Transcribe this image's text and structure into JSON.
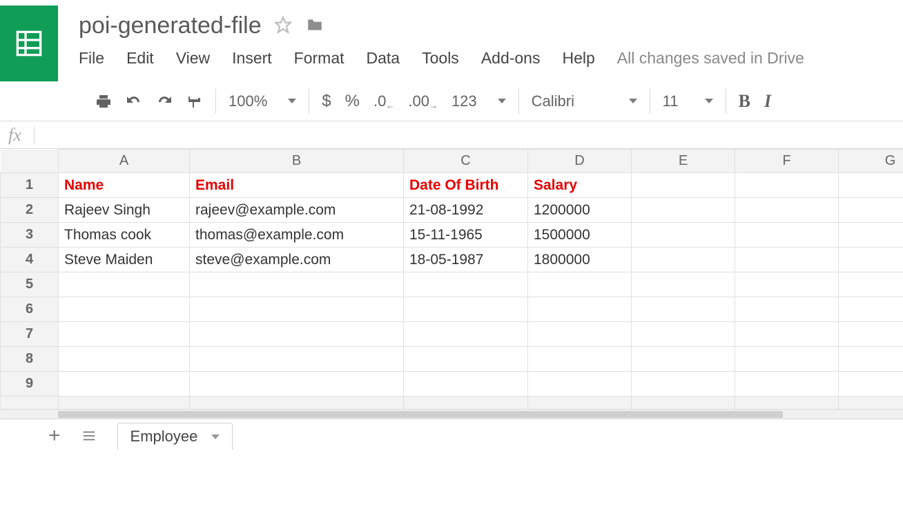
{
  "doc": {
    "title": "poi-generated-file",
    "save_status": "All changes saved in Drive"
  },
  "menu": {
    "file": "File",
    "edit": "Edit",
    "view": "View",
    "insert": "Insert",
    "format": "Format",
    "data": "Data",
    "tools": "Tools",
    "addons": "Add-ons",
    "help": "Help"
  },
  "toolbar": {
    "zoom": "100%",
    "currency": "$",
    "percent": "%",
    "dec_decrease": ".0",
    "dec_increase": ".00",
    "num_format": "123",
    "font_name": "Calibri",
    "font_size": "11",
    "bold": "B",
    "italic": "I"
  },
  "formula": {
    "fx": "fx",
    "value": ""
  },
  "columns": [
    "A",
    "B",
    "C",
    "D",
    "E",
    "F",
    "G"
  ],
  "row_numbers": [
    "1",
    "2",
    "3",
    "4",
    "5",
    "6",
    "7",
    "8",
    "9"
  ],
  "headers": {
    "name": "Name",
    "email": "Email",
    "dob": "Date Of Birth",
    "salary": "Salary"
  },
  "rows": [
    {
      "name": "Rajeev Singh",
      "email": "rajeev@example.com",
      "dob": "21-08-1992",
      "salary": "1200000"
    },
    {
      "name": "Thomas cook",
      "email": "thomas@example.com",
      "dob": "15-11-1965",
      "salary": "1500000"
    },
    {
      "name": "Steve Maiden",
      "email": "steve@example.com",
      "dob": "18-05-1987",
      "salary": "1800000"
    }
  ],
  "sheet": {
    "add": "+",
    "all": "≣",
    "tab_name": "Employee"
  }
}
